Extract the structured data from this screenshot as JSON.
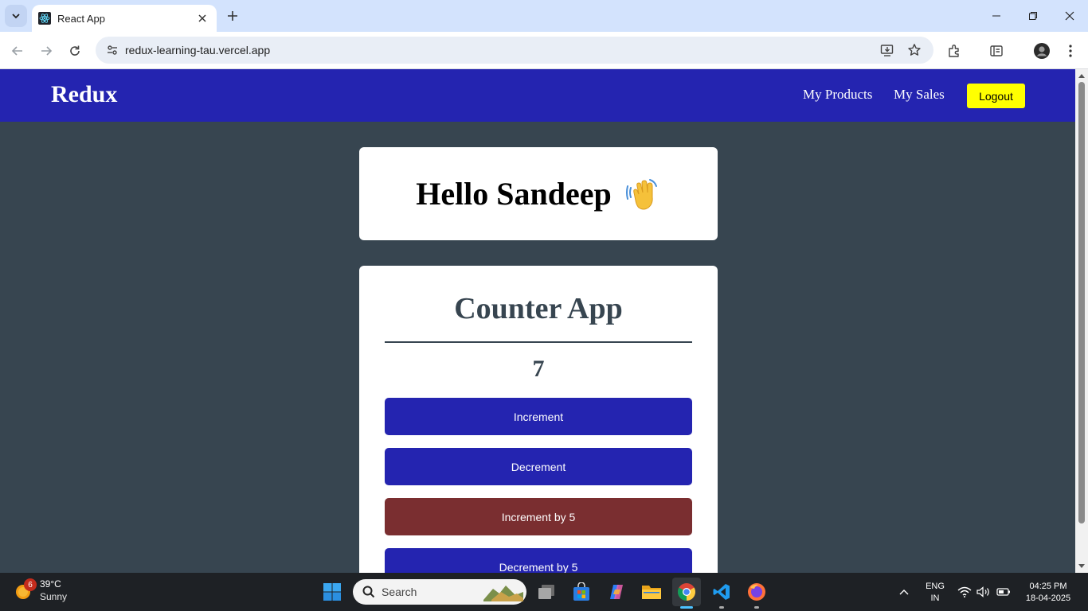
{
  "browser": {
    "tab_title": "React App",
    "url": "redux-learning-tau.vercel.app"
  },
  "app": {
    "brand": "Redux",
    "nav": {
      "products": "My Products",
      "sales": "My Sales",
      "logout": "Logout"
    },
    "greeting": "Hello Sandeep",
    "counter": {
      "title": "Counter App",
      "value": "7",
      "buttons": {
        "increment": "Increment",
        "decrement": "Decrement",
        "increment5": "Increment by 5",
        "decrement5": "Decrement by 5"
      }
    }
  },
  "colors": {
    "nav_bg": "#2424b0",
    "page_bg": "#374550",
    "logout_bg": "#ffff00",
    "button_primary": "#2424b0",
    "button_increment5": "#7a2e30"
  },
  "taskbar": {
    "weather": {
      "badge": "6",
      "temp": "39°C",
      "desc": "Sunny"
    },
    "search_placeholder": "Search",
    "language": {
      "line1": "ENG",
      "line2": "IN"
    },
    "clock": {
      "time": "04:25 PM",
      "date": "18-04-2025"
    }
  }
}
